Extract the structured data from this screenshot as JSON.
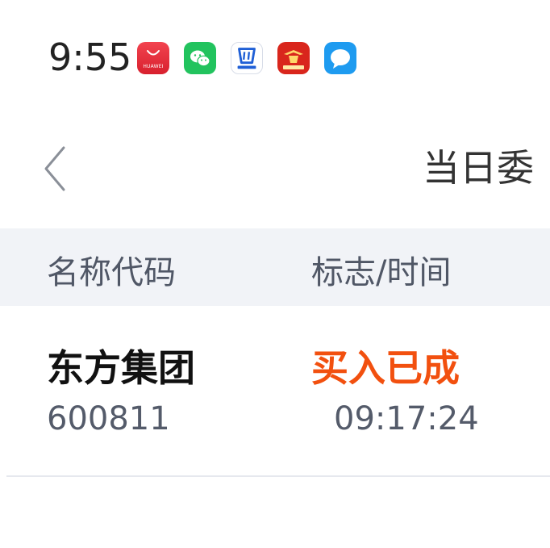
{
  "status_bar": {
    "time": "9:55",
    "icons": [
      {
        "name": "huawei-appgallery-icon",
        "label": "HUAWEI",
        "color": "#e8323c"
      },
      {
        "name": "wechat-icon",
        "color": "#22c35e"
      },
      {
        "name": "tongdaxin-icon",
        "color": "#1f5fd6"
      },
      {
        "name": "citic-securities-icon",
        "color": "#d9261c"
      },
      {
        "name": "messages-icon",
        "color": "#1e9bf0"
      }
    ]
  },
  "nav": {
    "back_icon": "chevron-left-icon",
    "title": "当日委"
  },
  "table": {
    "headers": {
      "name_code": "名称代码",
      "flag_time": "标志/时间"
    },
    "rows": [
      {
        "name": "东方集团",
        "code": "600811",
        "status": "买入已成",
        "time": "09:17:24"
      }
    ]
  },
  "colors": {
    "accent_status": "#f2500f",
    "header_bg": "#f1f3f7",
    "muted_text": "#545b6a"
  }
}
